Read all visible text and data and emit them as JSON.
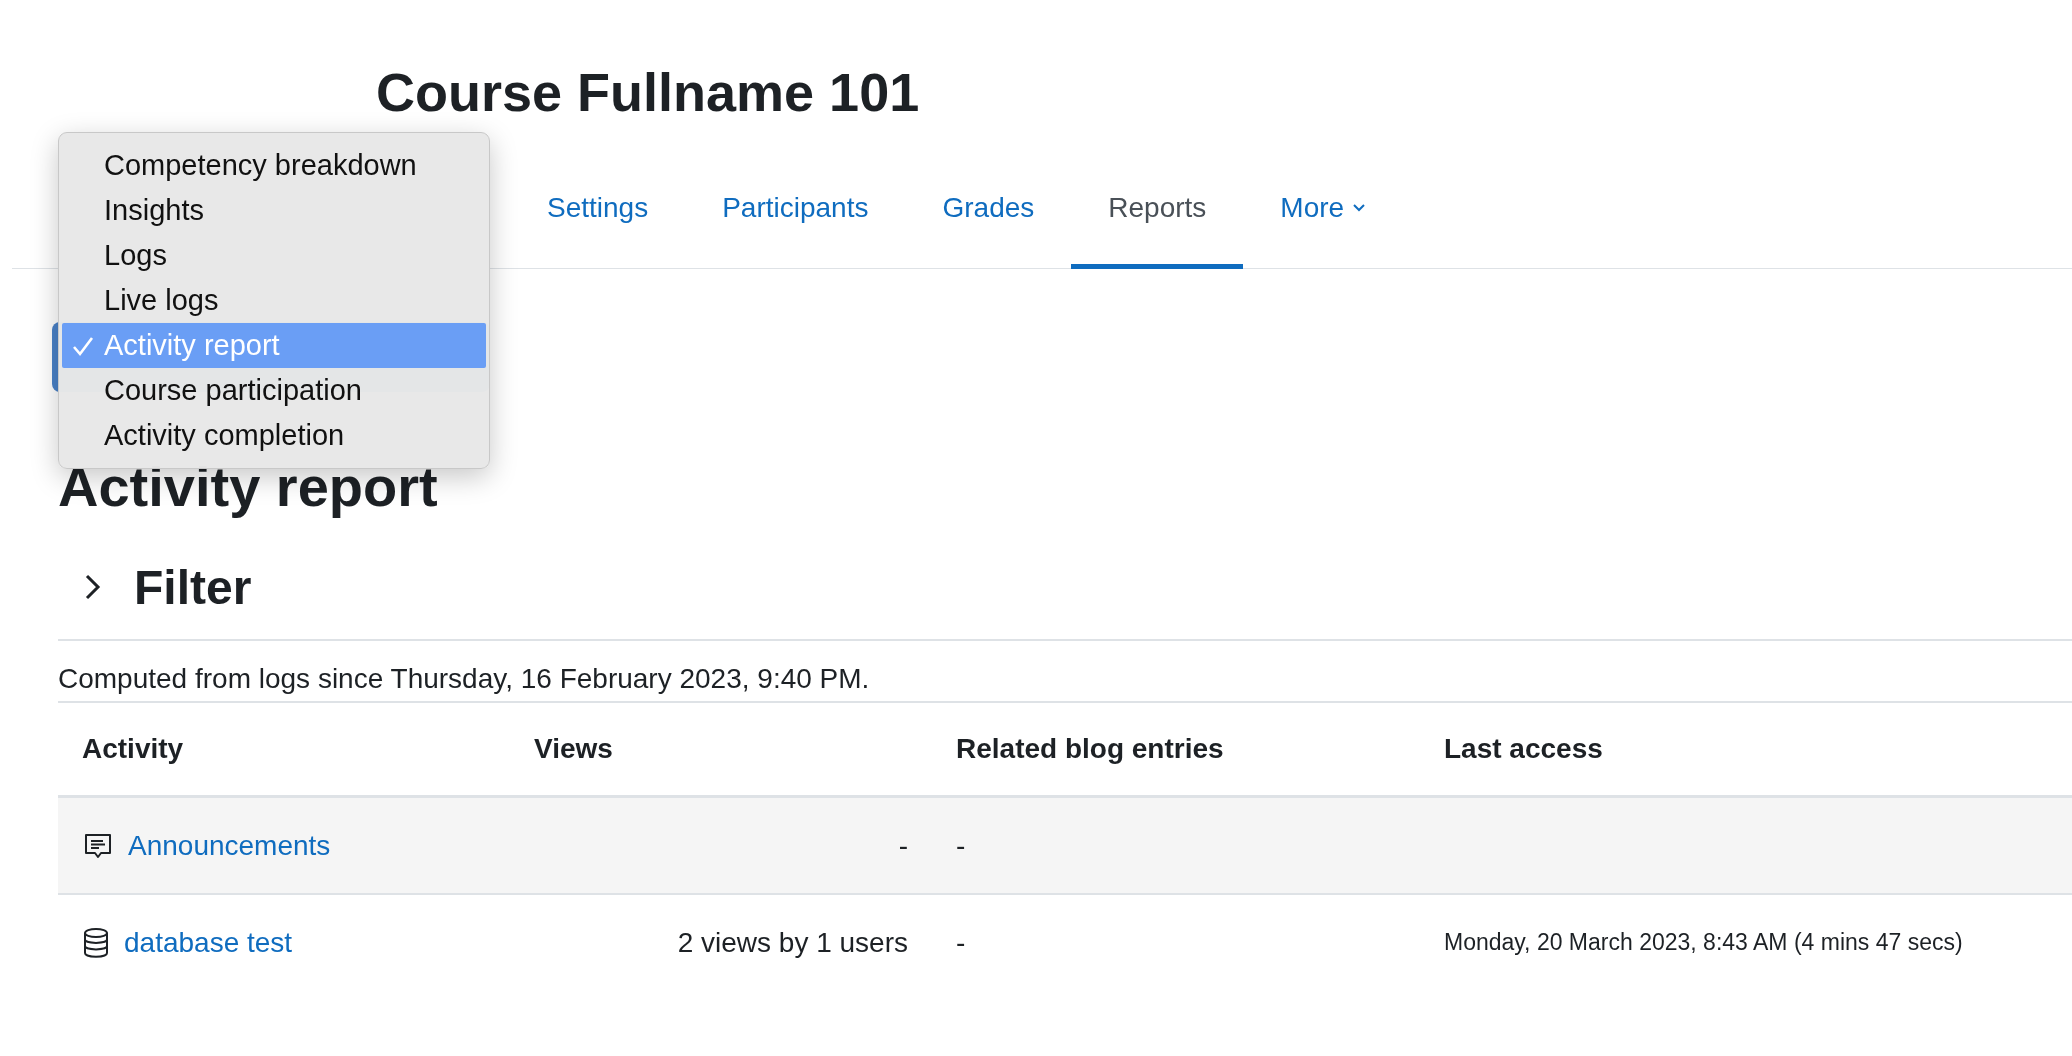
{
  "page": {
    "title": "Course Fullname 101"
  },
  "tabs": [
    {
      "label": "Settings",
      "selected": false,
      "kind": "link"
    },
    {
      "label": "Participants",
      "selected": false,
      "kind": "link"
    },
    {
      "label": "Grades",
      "selected": false,
      "kind": "link"
    },
    {
      "label": "Reports",
      "selected": true,
      "kind": "link"
    },
    {
      "label": "More",
      "selected": false,
      "kind": "dropdown"
    }
  ],
  "report_menu": {
    "items": [
      {
        "label": "Competency breakdown",
        "selected": false
      },
      {
        "label": "Insights",
        "selected": false
      },
      {
        "label": "Logs",
        "selected": false
      },
      {
        "label": "Live logs",
        "selected": false
      },
      {
        "label": "Activity report",
        "selected": true
      },
      {
        "label": "Course participation",
        "selected": false
      },
      {
        "label": "Activity completion",
        "selected": false
      }
    ]
  },
  "heading": "Activity report",
  "filter": {
    "title": "Filter",
    "expanded": false
  },
  "note": "Computed from logs since Thursday, 16 February 2023, 9:40 PM.",
  "table": {
    "columns": [
      "Activity",
      "Views",
      "Related blog entries",
      "Last access"
    ],
    "rows": [
      {
        "kind": "forum",
        "activity": "Announcements",
        "views": "-",
        "blog": "-"
      },
      {
        "kind": "database",
        "activity": "database test",
        "views": "2 views by 1 users",
        "blog": "-",
        "last_access": "Monday, 20 March 2023, 8:43 AM (4 mins 47 secs)"
      }
    ]
  }
}
